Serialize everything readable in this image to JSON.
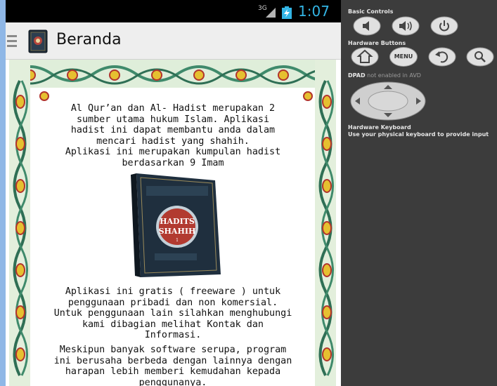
{
  "status": {
    "network": "3G",
    "time": "1:07"
  },
  "actionbar": {
    "title": "Beranda"
  },
  "content": {
    "paragraph1": "Al Qur’an dan Al- Hadist merupakan 2\nsumber utama hukum Islam. Aplikasi\nhadist ini dapat membantu anda dalam\nmencari hadist yang shahih.\nAplikasi ini merupakan kumpulan hadist\nberdasarkan 9 Imam",
    "book": {
      "title_line1": "HADITS",
      "title_line2": "SHAHIH",
      "volume": "1"
    },
    "paragraph2": "Aplikasi ini gratis ( freeware ) untuk\npenggunaan pribadi dan non komersial.\nUntuk penggunaan lain silahkan menghubungi\nkami dibagian melihat Kontak dan\nInformasi.",
    "paragraph3": "Meskipun banyak software serupa, program\nini berusaha berbeda dengan lainnya dengan\nharapan lebih memberi kemudahan kepada\npenggunanya."
  },
  "emulator": {
    "basic_controls": "Basic Controls",
    "hardware_buttons": "Hardware Buttons",
    "menu_label": "MENU",
    "dpad_label": "DPAD",
    "dpad_note": " not enabled in AVD",
    "keyboard_title": "Hardware Keyboard",
    "keyboard_note": "Use your physical keyboard to provide input"
  }
}
